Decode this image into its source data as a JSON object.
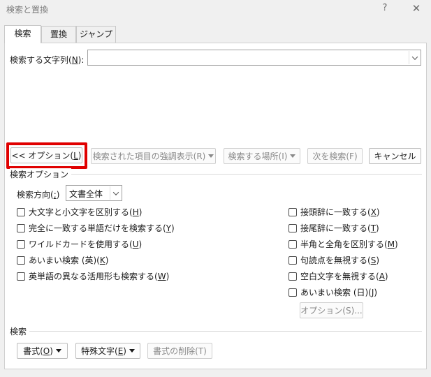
{
  "window": {
    "title": "検索と置換",
    "help": "?",
    "close": "✕"
  },
  "tabs": [
    {
      "label": "検索",
      "active": true
    },
    {
      "label": "置換",
      "active": false
    },
    {
      "label": "ジャンプ",
      "active": false
    }
  ],
  "find": {
    "label_prefix": "検索する文字列(",
    "label_key": "N",
    "label_suffix": "):",
    "value": ""
  },
  "buttons": {
    "options": {
      "prefix": "<< オプション(",
      "key": "L",
      "suffix": ")"
    },
    "reading_highlight": "検索された項目の強調表示(R)",
    "find_in": "検索する場所(I)",
    "find_next": "次を検索(F)",
    "cancel": "キャンセル"
  },
  "search_options": {
    "title": "検索オプション",
    "direction_label_prefix": "検索方向(",
    "direction_label_key": ";",
    "direction_label_suffix": ")",
    "direction_value": "文書全体",
    "left_options": [
      {
        "prefix": "大文字と小文字を区別する(",
        "key": "H",
        "suffix": ")",
        "checked": false
      },
      {
        "prefix": "完全に一致する単語だけを検索する(",
        "key": "Y",
        "suffix": ")",
        "checked": false
      },
      {
        "prefix": "ワイルドカードを使用する(",
        "key": "U",
        "suffix": ")",
        "checked": false
      },
      {
        "prefix": "あいまい検索 (英)(",
        "key": "K",
        "suffix": ")",
        "checked": false
      },
      {
        "prefix": "英単語の異なる活用形も検索する(",
        "key": "W",
        "suffix": ")",
        "checked": false
      }
    ],
    "right_options": [
      {
        "prefix": "接頭辞に一致する(",
        "key": "X",
        "suffix": ")",
        "checked": false
      },
      {
        "prefix": "接尾辞に一致する(",
        "key": "T",
        "suffix": ")",
        "checked": false
      },
      {
        "prefix": "半角と全角を区別する(",
        "key": "M",
        "suffix": ")",
        "checked": false
      },
      {
        "prefix": "句読点を無視する(",
        "key": "S",
        "suffix": ")",
        "checked": false
      },
      {
        "prefix": "空白文字を無視する(",
        "key": "A",
        "suffix": ")",
        "checked": false
      },
      {
        "prefix": "あいまい検索 (日)(",
        "key": "J",
        "suffix": ")",
        "checked": false
      }
    ],
    "fuzzy_options_button": "オプション(S)..."
  },
  "search_section": {
    "title": "検索",
    "format": {
      "prefix": "書式(",
      "key": "O",
      "suffix": ")"
    },
    "special": {
      "prefix": "特殊文字(",
      "key": "E",
      "suffix": ")"
    },
    "no_format": "書式の削除(T)"
  },
  "colors": {
    "highlight": "#e00000"
  }
}
